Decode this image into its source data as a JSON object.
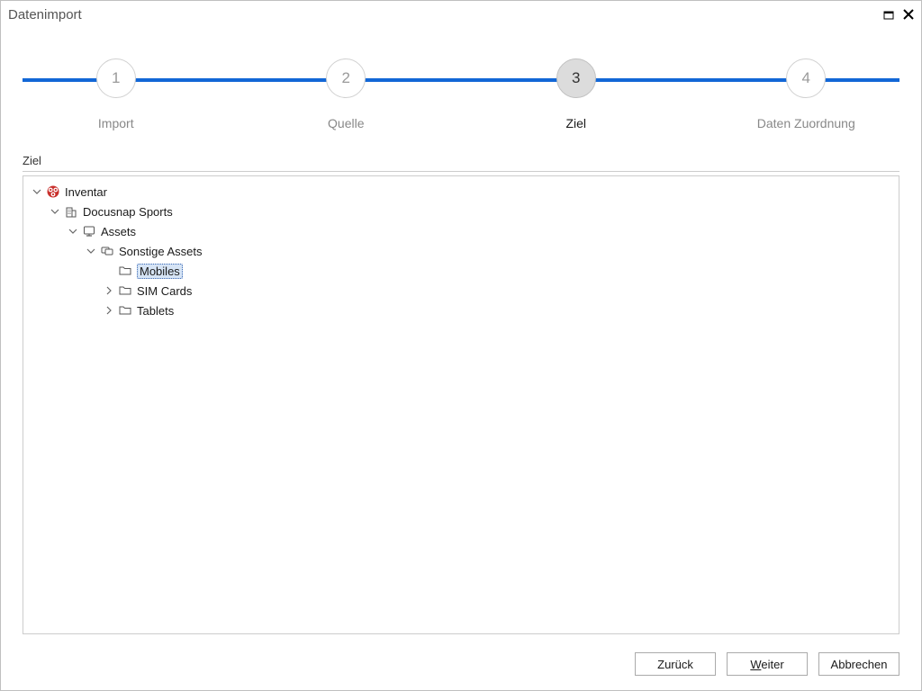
{
  "window": {
    "title": "Datenimport"
  },
  "stepper": {
    "steps": [
      {
        "num": "1",
        "label": "Import",
        "active": false
      },
      {
        "num": "2",
        "label": "Quelle",
        "active": false
      },
      {
        "num": "3",
        "label": "Ziel",
        "active": true
      },
      {
        "num": "4",
        "label": "Daten Zuordnung",
        "active": false
      }
    ]
  },
  "section": {
    "title": "Ziel"
  },
  "tree": {
    "root": {
      "label": "Inventar"
    },
    "company": {
      "label": "Docusnap Sports"
    },
    "assets": {
      "label": "Assets"
    },
    "other_assets": {
      "label": "Sonstige Assets"
    },
    "mobiles": {
      "label": "Mobiles"
    },
    "sim": {
      "label": "SIM Cards"
    },
    "tablets": {
      "label": "Tablets"
    }
  },
  "buttons": {
    "back": "Zurück",
    "next_prefix": "W",
    "next_rest": "eiter",
    "cancel": "Abbrechen"
  }
}
